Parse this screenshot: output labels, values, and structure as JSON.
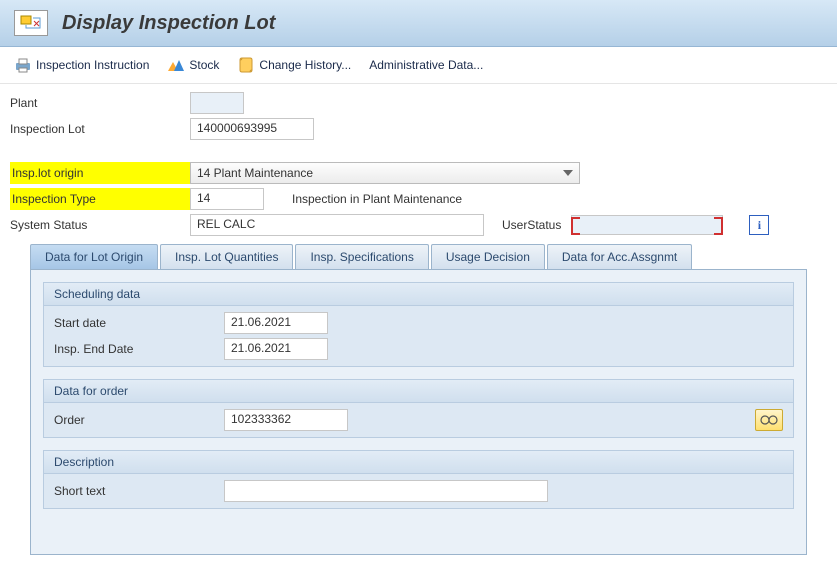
{
  "title": "Display Inspection Lot",
  "toolbar": {
    "inspection_instruction": "Inspection Instruction",
    "stock": "Stock",
    "change_history": "Change History...",
    "admin_data": "Administrative Data..."
  },
  "header": {
    "plant_label": "Plant",
    "plant_value": "",
    "lot_label": "Inspection Lot",
    "lot_value": "140000693995",
    "origin_label": "Insp.lot origin",
    "origin_value": "14 Plant Maintenance",
    "type_label": "Inspection Type",
    "type_value": "14",
    "type_desc": "Inspection in Plant Maintenance",
    "sys_status_label": "System Status",
    "sys_status_value": "REL  CALC",
    "user_status_label": "UserStatus",
    "user_status_value": ""
  },
  "tabs": [
    "Data for Lot Origin",
    "Insp. Lot Quantities",
    "Insp. Specifications",
    "Usage Decision",
    "Data for Acc.Assgnmt"
  ],
  "active_tab": 0,
  "groups": {
    "scheduling": {
      "title": "Scheduling data",
      "start_label": "Start date",
      "start_value": "21.06.2021",
      "end_label": "Insp. End Date",
      "end_value": "21.06.2021"
    },
    "order": {
      "title": "Data for order",
      "order_label": "Order",
      "order_value": "102333362"
    },
    "description": {
      "title": "Description",
      "short_label": "Short text",
      "short_value": ""
    }
  }
}
